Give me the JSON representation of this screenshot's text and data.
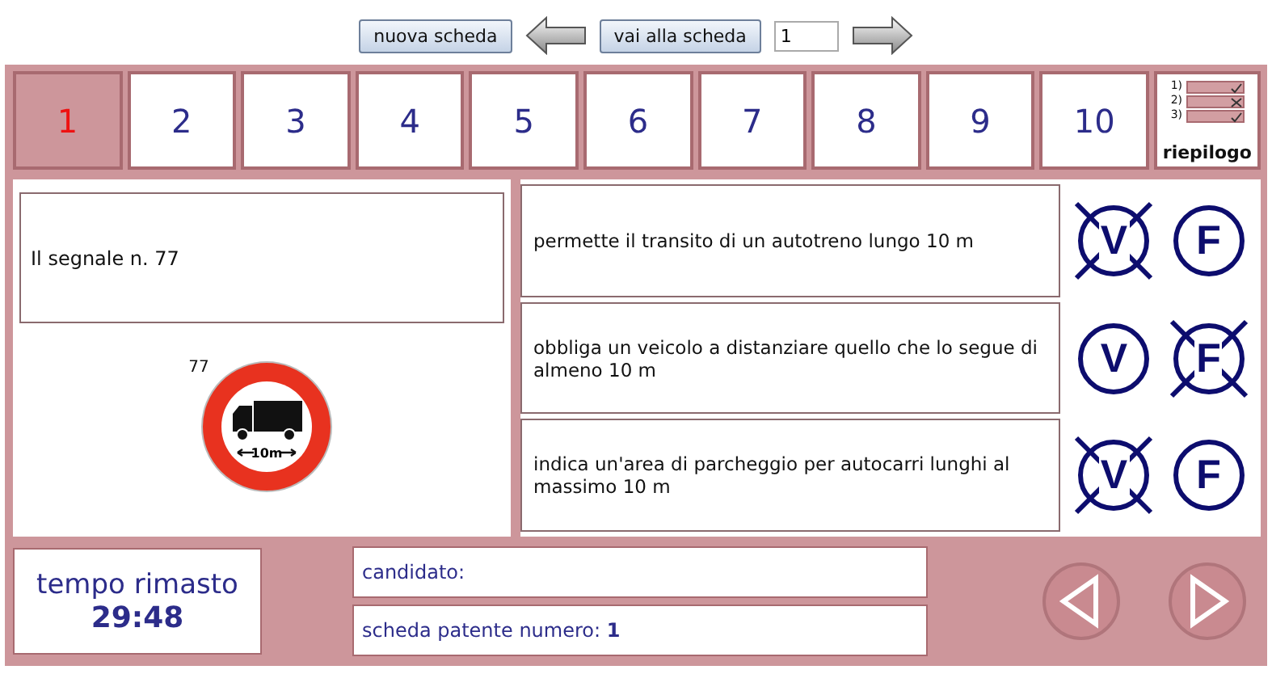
{
  "toolbar": {
    "new_button": "nuova scheda",
    "go_button": "vai alla scheda",
    "sheet_input": "1"
  },
  "tabs": [
    {
      "label": "1",
      "selected": true
    },
    {
      "label": "2",
      "selected": false
    },
    {
      "label": "3",
      "selected": false
    },
    {
      "label": "4",
      "selected": false
    },
    {
      "label": "5",
      "selected": false
    },
    {
      "label": "6",
      "selected": false
    },
    {
      "label": "7",
      "selected": false
    },
    {
      "label": "8",
      "selected": false
    },
    {
      "label": "9",
      "selected": false
    },
    {
      "label": "10",
      "selected": false
    }
  ],
  "summary": {
    "label": "riepilogo",
    "lines": [
      {
        "number": "1)",
        "kind": "check"
      },
      {
        "number": "2)",
        "kind": "cross"
      },
      {
        "number": "3)",
        "kind": "check"
      }
    ]
  },
  "question": {
    "text": "Il segnale n. 77",
    "sign_number": "77",
    "sign_length": "10m"
  },
  "answers": [
    {
      "text": "permette il transito di un autotreno lungo 10 m",
      "true_label": "V",
      "false_label": "F",
      "true_crossed": true,
      "false_crossed": false
    },
    {
      "text": "obbliga un veicolo a distanziare quello che lo segue di almeno 10 m",
      "true_label": "V",
      "false_label": "F",
      "true_crossed": false,
      "false_crossed": true
    },
    {
      "text": "indica un'area di parcheggio per autocarri lunghi al massimo 10 m",
      "true_label": "V",
      "false_label": "F",
      "true_crossed": true,
      "false_crossed": false
    }
  ],
  "timer": {
    "label": "tempo rimasto",
    "value": "29:48"
  },
  "candidate": {
    "label": "candidato:"
  },
  "sheet_number": {
    "text": "scheda patente numero: **1**"
  }
}
